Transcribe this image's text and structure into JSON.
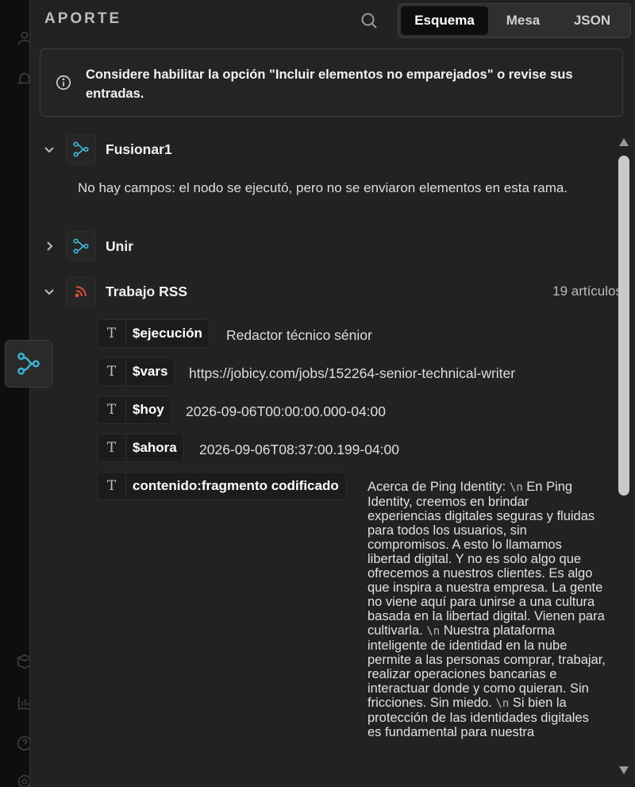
{
  "panel": {
    "title": "APORTE",
    "tabs": [
      {
        "label": "Esquema",
        "active": true
      },
      {
        "label": "Mesa",
        "active": false
      },
      {
        "label": "JSON",
        "active": false
      }
    ]
  },
  "notice": {
    "text": "Considere habilitar la opción \"Incluir elementos no emparejados\" o revise sus entradas."
  },
  "nodes": [
    {
      "name": "Fusionar1",
      "expanded": true,
      "empty_message": "No hay campos: el nodo se ejecutó, pero no se enviaron elementos en esta rama."
    },
    {
      "name": "Unir",
      "expanded": false
    },
    {
      "name": "Trabajo RSS",
      "expanded": true,
      "count": "19 artículos"
    }
  ],
  "fields": [
    {
      "name": "$ejecución",
      "value": "Redactor técnico sénior"
    },
    {
      "name": "$vars",
      "value": "https://jobicy.com/jobs/152264-senior-technical-writer"
    },
    {
      "name": "$hoy",
      "value": "2026-09-06T00:00:00.000-04:00"
    },
    {
      "name": "$ahora",
      "value": "2026-09-06T08:37:00.199-04:00"
    },
    {
      "name": "contenido:fragmento codificado",
      "value": ""
    }
  ],
  "long_value_parts": {
    "p1": "Acerca de Ping Identity: ",
    "nl": "\\n",
    "p2": " En Ping Identity, creemos en brindar experiencias digitales seguras y fluidas para todos los usuarios, sin compromisos. A esto lo llamamos libertad digital. Y no es solo algo que ofrecemos a nuestros clientes. Es algo que inspira a nuestra empresa. La gente no viene aquí para unirse a una cultura basada en la libertad digital. Vienen para cultivarla. ",
    "p3": " Nuestra plataforma inteligente de identidad en la nube permite a las personas comprar, trabajar, realizar operaciones bancarias e interactuar donde y como quieran. Sin fricciones. Sin miedo. ",
    "p4": " Si bien la protección de las identidades digitales es fundamental para nuestra"
  },
  "colors": {
    "node_icon": "#3ab7d8",
    "rss_icon": "#e8563a",
    "panel_bg": "#222222"
  },
  "icons": {
    "search": "search-icon",
    "info": "info-icon",
    "merge": "merge-node-icon",
    "rss": "rss-icon",
    "text_type": "text-type-icon"
  }
}
